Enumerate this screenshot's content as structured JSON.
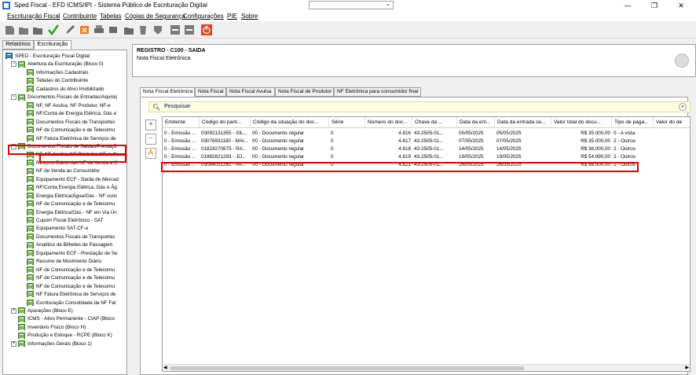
{
  "window": {
    "title": "Sped Fiscal - EFD ICMS/IPI - Sistema Público de Escrituração Digital",
    "dropdown_arrow": "⌄",
    "minimize": "—",
    "restore": "❐",
    "close": "✕"
  },
  "menu": [
    "Escrituração Fiscal",
    "Contribuinte",
    "Tabelas",
    "Cópias de Segurança",
    "Configurações",
    "PIE",
    "Sobre"
  ],
  "left_tabs": [
    "Relatórios",
    "Escrituração"
  ],
  "tree": [
    {
      "label": "SPED - Escrituração Fiscal Digital",
      "exp": "",
      "root": true
    },
    {
      "label": "Abertura da Escrituração (Bloco 0)",
      "exp": "−"
    },
    {
      "label": "Informações Cadastrais",
      "exp": ""
    },
    {
      "label": "Tabelas do Contribuinte",
      "exp": ""
    },
    {
      "label": "Cadastros do Ativo Imobilizado",
      "exp": ""
    },
    {
      "label": "Documentos Fiscais de Entradas/Aquisiç",
      "exp": "−"
    },
    {
      "label": "NF, NF Avulsa, NF Produtor, NF-e",
      "exp": ""
    },
    {
      "label": "NF/Conta de Energia Elétrica, Gás e",
      "exp": ""
    },
    {
      "label": "Documentos Fiscais de Transportes",
      "exp": ""
    },
    {
      "label": "NF de Comunicação e de Telecomu",
      "exp": ""
    },
    {
      "label": "NF Fatura Eletrônica de Serviços de",
      "exp": ""
    },
    {
      "label": "Documentos Fiscais de Saídas/Prestaçõ",
      "exp": "−"
    },
    {
      "label": "NF, NF Avulsa, NF Produtor, NF-e, N",
      "exp": ""
    },
    {
      "label": "Resumo Diário das NF de Venda a C",
      "exp": ""
    },
    {
      "label": "NF de Venda ao Consumidor",
      "exp": ""
    },
    {
      "label": "Equipamento ECF - Saída de Mercad",
      "exp": ""
    },
    {
      "label": "NF/Conta Energia Elétrica, Gás e Ág",
      "exp": ""
    },
    {
      "label": "Energia Elétrica/Água/Gás - NF conc",
      "exp": ""
    },
    {
      "label": "NF de Comunicação e de Telecomu",
      "exp": ""
    },
    {
      "label": "Energia Elétrica/Gás - NF em Via Ún",
      "exp": ""
    },
    {
      "label": "Cupom Fiscal Eletrônico - SAT",
      "exp": ""
    },
    {
      "label": "Equipamento SAT-CF-e",
      "exp": ""
    },
    {
      "label": "Documentos Fiscais de Transportes",
      "exp": ""
    },
    {
      "label": "Analítico de Bilhetes de Passagem",
      "exp": ""
    },
    {
      "label": "Equipamento ECF - Prestação de Se",
      "exp": ""
    },
    {
      "label": "Resumo de Movimento Diário",
      "exp": ""
    },
    {
      "label": "NF de Comunicação e de Telecomu",
      "exp": ""
    },
    {
      "label": "NF de Comunicação e de Telecomu",
      "exp": ""
    },
    {
      "label": "NF de Comunicação e de Telecomu",
      "exp": ""
    },
    {
      "label": "NF Fatura Eletrônica de Serviços de",
      "exp": ""
    },
    {
      "label": "Escrituração Consolidada da NF Fat",
      "exp": ""
    },
    {
      "label": "Apurações (Bloco E)",
      "exp": "+"
    },
    {
      "label": "ICMS - Ativo Permanente - CIAP (Bloco",
      "exp": ""
    },
    {
      "label": "Inventário Físico (Bloco H)",
      "exp": ""
    },
    {
      "label": "Produção e Estoque - RCPE (Bloco K)",
      "exp": ""
    },
    {
      "label": "Informações Gerais (Bloco 1)",
      "exp": "+"
    }
  ],
  "register": {
    "title": "REGISTRO - C100 - SAIDA",
    "subtitle": "Nota Fiscal Eletrônica"
  },
  "detail_tabs": [
    "Nota Fiscal Eletrônica",
    "Nota Fiscal",
    "Nota Fiscal Avulsa",
    "Nota Fiscal de Produtor",
    "NF Eletrônica para consumidor final"
  ],
  "search": {
    "label": "Pesquisar"
  },
  "side_buttons": [
    "+",
    "−",
    "A"
  ],
  "columns": [
    "Emitente",
    "Código do parti...",
    "Código da situação do doc...",
    "Série",
    "Número do doc...",
    "Chave da ...",
    "Data da em...",
    "Data da entrada ou...",
    "Valor total do docu...",
    "Tipo de paga...",
    "Valor do de"
  ],
  "rows": [
    [
      "0 - Emissão ...",
      "03092131355 - SIL...",
      "00 - Documento regular",
      "0",
      "4.816",
      "43-2505-01...",
      "05/05/2025",
      "05/05/2025",
      "R$ 35.000,00",
      "0 - A vista",
      ""
    ],
    [
      "0 - Emissão ...",
      "03076931180 - MAI...",
      "00 - Documento regular",
      "0",
      "4.817",
      "43-2505-01...",
      "07/05/2025",
      "07/05/2025",
      "R$ 35.000,00",
      "2 - Outros",
      ""
    ],
    [
      "0 - Emissão ...",
      "01819270675 - RA...",
      "00 - Documento regular",
      "0",
      "4.818",
      "43-2505-01...",
      "14/05/2025",
      "14/05/2025",
      "R$ 38.000,00",
      "2 - Outros",
      ""
    ],
    [
      "0 - Emissão ...",
      "01882821293 - JO...",
      "00 - Documento regular",
      "0",
      "4.819",
      "43-2505-01...",
      "19/05/2025",
      "19/05/2025",
      "R$ 54.990,00",
      "2 - Outros",
      ""
    ],
    [
      "0 - Emissão ...",
      "03084031261 - PA...",
      "00 - Documento regular",
      "0",
      "4.821",
      "43-2505-01...",
      "26/05/2025",
      "26/05/2025",
      "R$ 58.000,00",
      "2 - Outros",
      ""
    ]
  ],
  "colors": {
    "highlight": "#e00000",
    "tree_icon": "#7fb85a"
  }
}
